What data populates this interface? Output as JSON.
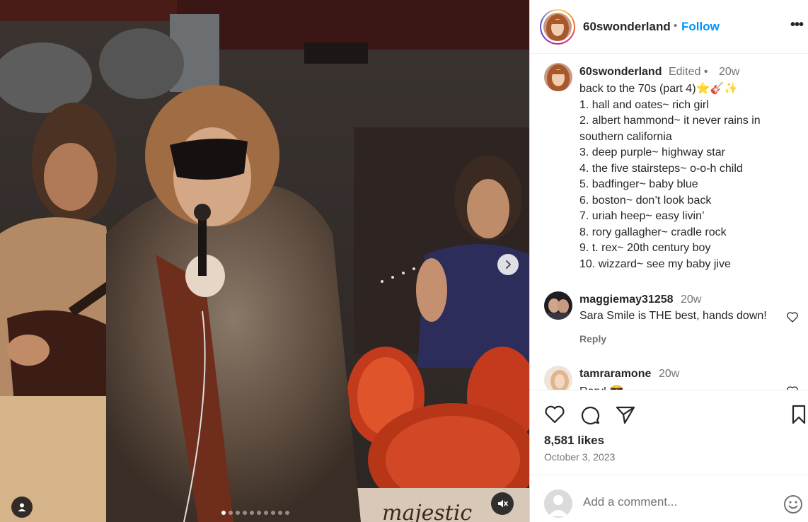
{
  "post": {
    "username": "60swonderland",
    "follow_label": "Follow",
    "header_separator": "•",
    "more_label": "•••"
  },
  "caption": {
    "username": "60swonderland",
    "edited": "Edited •",
    "time": "20w",
    "lines": [
      "back to the 70s (part 4)⭐🎸✨",
      "1. hall and oates~ rich girl",
      "2. albert hammond~ it never rains in",
      "southern california",
      "3. deep purple~ highway star",
      "4. the five stairsteps~ o-o-h child",
      "5. badfinger~ baby blue",
      "6. boston~ don’t look back",
      "7. uriah heep~ easy livin’",
      "8. rory gallagher~ cradle rock",
      "9. t. rex~ 20th century boy",
      "10. wizzard~ see my baby jive"
    ]
  },
  "comments": [
    {
      "username": "maggiemay31258",
      "time": "20w",
      "text": "Sara Smile is THE best, hands down!",
      "reply_label": "Reply"
    },
    {
      "username": "tamraramone",
      "time": "20w",
      "text": "Rory! 😎"
    }
  ],
  "likes": "8,581 likes",
  "date": "October 3, 2023",
  "add_comment": {
    "placeholder": "Add a comment..."
  },
  "media": {
    "carousel_count": 10,
    "carousel_active": 1,
    "drum_brand": "majestic"
  },
  "colors": {
    "accent": "#0095f6",
    "text_primary": "#262626",
    "text_secondary": "#737373"
  },
  "icons": [
    "chevron-right-icon",
    "user-tag-icon",
    "mute-icon",
    "heart-icon",
    "comment-icon",
    "share-icon",
    "bookmark-icon",
    "emoji-icon",
    "more-icon"
  ]
}
